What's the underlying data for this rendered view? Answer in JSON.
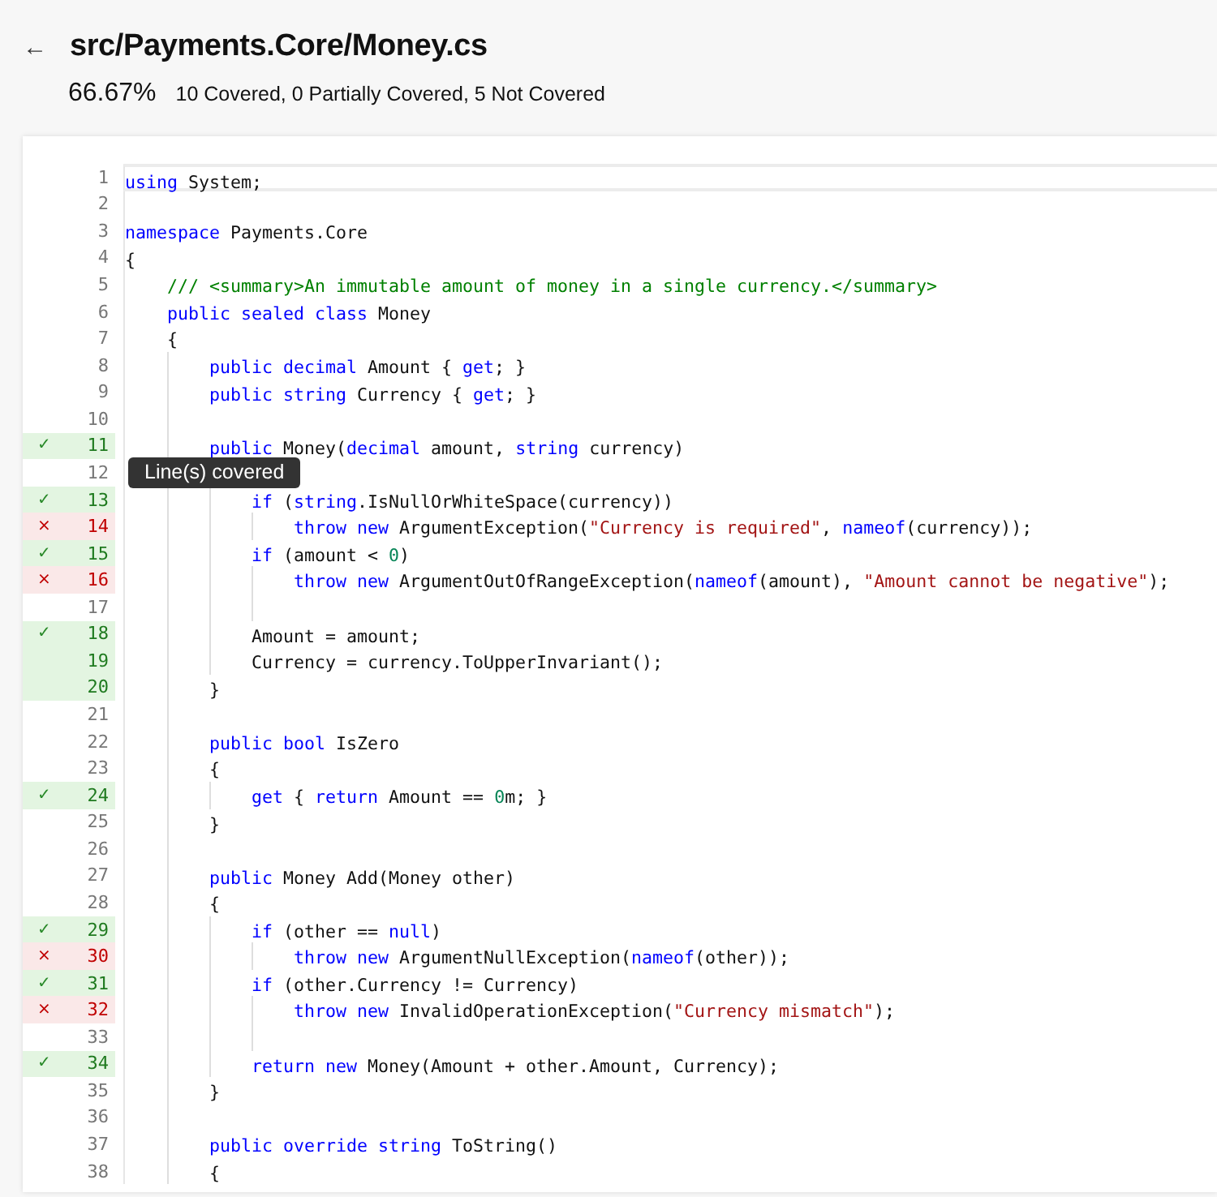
{
  "header": {
    "back": "←",
    "title": "src/Payments.Core/Money.cs",
    "percent": "66.67%",
    "summary": "10 Covered, 0 Partially Covered, 5 Not Covered"
  },
  "tooltip": {
    "text": "Line(s) covered"
  },
  "lines": [
    {
      "number": "1",
      "covered": false,
      "missed": false,
      "current": true,
      "code": [
        {
          "kind": "keyword",
          "t": "using"
        },
        {
          "t": " System;"
        }
      ]
    },
    {
      "number": "2",
      "covered": false,
      "missed": false,
      "current": false
    },
    {
      "number": "3",
      "covered": false,
      "missed": false,
      "current": false,
      "code": [
        {
          "kind": "keyword",
          "t": "namespace"
        },
        {
          "t": " Payments.Core"
        }
      ]
    },
    {
      "number": "4",
      "covered": false,
      "missed": false,
      "current": false,
      "code": [
        {
          "t": "{"
        }
      ]
    },
    {
      "number": "5",
      "covered": false,
      "missed": false,
      "current": false,
      "code": [
        {
          "kind": "comment",
          "t": "    /// <summary>An immutable amount of money in a single currency.</summary>"
        }
      ]
    },
    {
      "number": "6",
      "covered": false,
      "missed": false,
      "current": false,
      "code": [
        {
          "kind": "keyword",
          "t": "    public sealed class"
        },
        {
          "t": " Money"
        }
      ]
    },
    {
      "number": "7",
      "covered": false,
      "missed": false,
      "current": false,
      "code": [
        {
          "t": "    {"
        }
      ]
    },
    {
      "number": "8",
      "covered": false,
      "missed": false,
      "current": false,
      "code": [
        {
          "kind": "keyword",
          "t": "        public decimal"
        },
        {
          "t": " Amount { "
        },
        {
          "kind": "keyword",
          "t": "get"
        },
        {
          "t": "; }"
        }
      ]
    },
    {
      "number": "9",
      "covered": false,
      "missed": false,
      "current": false,
      "code": [
        {
          "kind": "keyword",
          "t": "        public string"
        },
        {
          "t": " Currency { "
        },
        {
          "kind": "keyword",
          "t": "get"
        },
        {
          "t": "; }"
        }
      ]
    },
    {
      "number": "10",
      "covered": false,
      "missed": false,
      "current": false
    },
    {
      "number": "11",
      "covered": true,
      "missed": false,
      "mark": "✓",
      "current": false,
      "code": [
        {
          "kind": "keyword",
          "t": "        public"
        },
        {
          "t": " Money("
        },
        {
          "kind": "keyword",
          "t": "decimal"
        },
        {
          "t": " amount, "
        },
        {
          "kind": "keyword",
          "t": "string"
        },
        {
          "t": " currency)"
        }
      ]
    },
    {
      "number": "12",
      "covered": false,
      "missed": false,
      "current": false,
      "tooltip": true
    },
    {
      "number": "13",
      "covered": true,
      "missed": false,
      "mark": "✓",
      "current": false,
      "code": [
        {
          "kind": "keyword",
          "t": "            if"
        },
        {
          "t": " ("
        },
        {
          "kind": "keyword",
          "t": "string"
        },
        {
          "t": ".IsNullOrWhiteSpace(currency))"
        }
      ]
    },
    {
      "number": "14",
      "covered": false,
      "missed": true,
      "mark": "×",
      "current": false,
      "code": [
        {
          "kind": "keyword",
          "t": "                throw new"
        },
        {
          "t": " ArgumentException("
        },
        {
          "kind": "string",
          "t": "\"Currency is required\""
        },
        {
          "t": ", "
        },
        {
          "kind": "keyword",
          "t": "nameof"
        },
        {
          "t": "(currency));"
        }
      ]
    },
    {
      "number": "15",
      "covered": true,
      "missed": false,
      "mark": "✓",
      "current": false,
      "code": [
        {
          "kind": "keyword",
          "t": "            if"
        },
        {
          "t": " (amount < "
        },
        {
          "kind": "number",
          "t": "0"
        },
        {
          "t": ")"
        }
      ]
    },
    {
      "number": "16",
      "covered": false,
      "missed": true,
      "mark": "×",
      "current": false,
      "code": [
        {
          "kind": "keyword",
          "t": "                throw new"
        },
        {
          "t": " ArgumentOutOfRangeException("
        },
        {
          "kind": "keyword",
          "t": "nameof"
        },
        {
          "t": "(amount), "
        },
        {
          "kind": "string",
          "t": "\"Amount cannot be negative\""
        },
        {
          "t": ");"
        }
      ]
    },
    {
      "number": "17",
      "covered": false,
      "missed": false,
      "current": false
    },
    {
      "number": "18",
      "covered": true,
      "missed": false,
      "mark": "✓",
      "current": false,
      "code": [
        {
          "t": "            Amount = amount;"
        }
      ]
    },
    {
      "number": "19",
      "covered": true,
      "missed": false,
      "current": false,
      "code": [
        {
          "t": "            Currency = currency.ToUpperInvariant();"
        }
      ]
    },
    {
      "number": "20",
      "covered": true,
      "missed": false,
      "current": false,
      "code": [
        {
          "t": "        }"
        }
      ]
    },
    {
      "number": "21",
      "covered": false,
      "missed": false,
      "current": false
    },
    {
      "number": "22",
      "covered": false,
      "missed": false,
      "current": false,
      "code": [
        {
          "kind": "keyword",
          "t": "        public bool"
        },
        {
          "t": " IsZero"
        }
      ]
    },
    {
      "number": "23",
      "covered": false,
      "missed": false,
      "current": false,
      "code": [
        {
          "t": "        {"
        }
      ]
    },
    {
      "number": "24",
      "covered": true,
      "missed": false,
      "mark": "✓",
      "current": false,
      "code": [
        {
          "kind": "keyword",
          "t": "            get"
        },
        {
          "t": " { "
        },
        {
          "kind": "keyword",
          "t": "return"
        },
        {
          "t": " Amount == "
        },
        {
          "kind": "number",
          "t": "0"
        },
        {
          "t": "m; }"
        }
      ]
    },
    {
      "number": "25",
      "covered": false,
      "missed": false,
      "current": false,
      "code": [
        {
          "t": "        }"
        }
      ]
    },
    {
      "number": "26",
      "covered": false,
      "missed": false,
      "current": false
    },
    {
      "number": "27",
      "covered": false,
      "missed": false,
      "current": false,
      "code": [
        {
          "kind": "keyword",
          "t": "        public"
        },
        {
          "t": " Money Add(Money other)"
        }
      ]
    },
    {
      "number": "28",
      "covered": false,
      "missed": false,
      "current": false,
      "code": [
        {
          "t": "        {"
        }
      ]
    },
    {
      "number": "29",
      "covered": true,
      "missed": false,
      "mark": "✓",
      "current": false,
      "code": [
        {
          "kind": "keyword",
          "t": "            if"
        },
        {
          "t": " (other == "
        },
        {
          "kind": "keyword",
          "t": "null"
        },
        {
          "t": ")"
        }
      ]
    },
    {
      "number": "30",
      "covered": false,
      "missed": true,
      "mark": "×",
      "current": false,
      "code": [
        {
          "kind": "keyword",
          "t": "                throw new"
        },
        {
          "t": " ArgumentNullException("
        },
        {
          "kind": "keyword",
          "t": "nameof"
        },
        {
          "t": "(other));"
        }
      ]
    },
    {
      "number": "31",
      "covered": true,
      "missed": false,
      "mark": "✓",
      "current": false,
      "code": [
        {
          "kind": "keyword",
          "t": "            if"
        },
        {
          "t": " (other.Currency != Currency)"
        }
      ]
    },
    {
      "number": "32",
      "covered": false,
      "missed": true,
      "mark": "×",
      "current": false,
      "code": [
        {
          "kind": "keyword",
          "t": "                throw new"
        },
        {
          "t": " InvalidOperationException("
        },
        {
          "kind": "string",
          "t": "\"Currency mismatch\""
        },
        {
          "t": ");"
        }
      ]
    },
    {
      "number": "33",
      "covered": false,
      "missed": false,
      "current": false
    },
    {
      "number": "34",
      "covered": true,
      "missed": false,
      "mark": "✓",
      "current": false,
      "code": [
        {
          "kind": "keyword",
          "t": "            return new"
        },
        {
          "t": " Money(Amount + other.Amount, Currency);"
        }
      ]
    },
    {
      "number": "35",
      "covered": false,
      "missed": false,
      "current": false,
      "code": [
        {
          "t": "        }"
        }
      ]
    },
    {
      "number": "36",
      "covered": false,
      "missed": false,
      "current": false
    },
    {
      "number": "37",
      "covered": false,
      "missed": false,
      "current": false,
      "code": [
        {
          "kind": "keyword",
          "t": "        public override string"
        },
        {
          "t": " ToString()"
        }
      ]
    },
    {
      "number": "38",
      "covered": false,
      "missed": false,
      "current": false,
      "code": [
        {
          "t": "        {"
        }
      ]
    }
  ]
}
